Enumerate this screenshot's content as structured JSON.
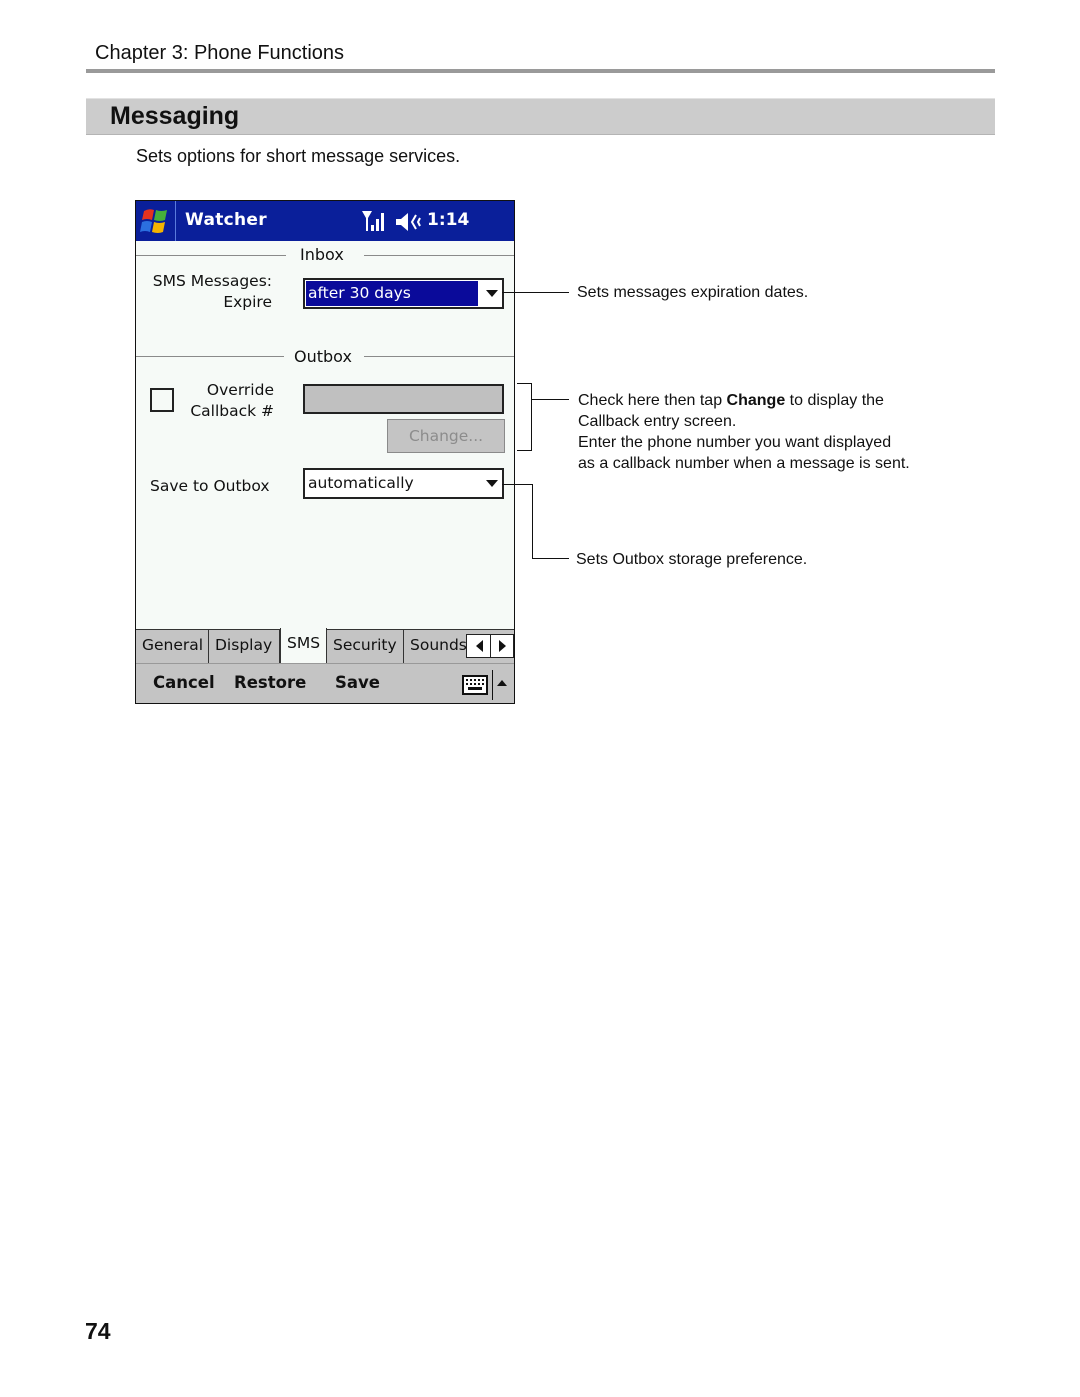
{
  "header": {
    "chapter": "Chapter 3: Phone Functions"
  },
  "section": {
    "title": "Messaging",
    "intro": "Sets options for short message services."
  },
  "device": {
    "titlebar": {
      "app_title": "Watcher",
      "clock": "1:14",
      "icons": [
        "windows-start-icon",
        "signal-icon",
        "speaker-icon"
      ]
    },
    "inbox": {
      "group_label": "Inbox",
      "sms_label_line1": "SMS Messages:",
      "sms_label_line2": "Expire",
      "expire_value": "after 30 days"
    },
    "outbox": {
      "group_label": "Outbox",
      "override_line1": "Override",
      "override_line2": "Callback #",
      "override_checked": false,
      "callback_value": "",
      "change_button": "Change...",
      "save_label": "Save to Outbox",
      "save_value": "automatically"
    },
    "tabs": [
      {
        "label": "General",
        "active": false
      },
      {
        "label": "Display",
        "active": false
      },
      {
        "label": "SMS",
        "active": true
      },
      {
        "label": "Security",
        "active": false
      },
      {
        "label": "Sounds",
        "active": false
      }
    ],
    "menubar": {
      "cancel": "Cancel",
      "restore": "Restore",
      "save": "Save"
    }
  },
  "callouts": {
    "expire": "Sets messages expiration dates.",
    "callback_pre": "Check here then tap ",
    "callback_bold": "Change",
    "callback_post": " to display the",
    "callback_line2": "Callback entry screen.",
    "callback_line3": "Enter the phone number you want displayed",
    "callback_line4": "as a callback number when a message is sent.",
    "outbox": "Sets Outbox storage preference."
  },
  "footer": {
    "page_number": "74"
  }
}
